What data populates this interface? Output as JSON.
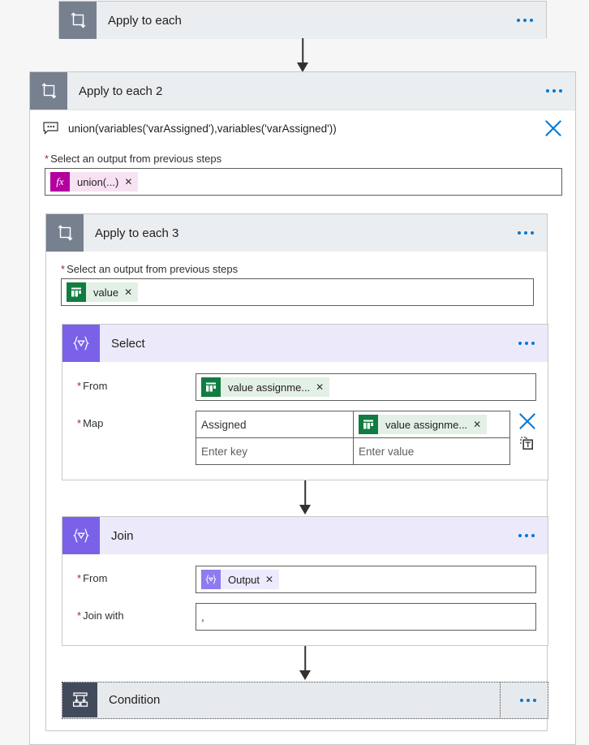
{
  "canvas": {
    "background": "#f6f6f6"
  },
  "colors": {
    "loop_header_icon": "#76808f",
    "loop_header_bar": "#eaeef1",
    "data_op_icon": "#7b61e8",
    "data_op_bar": "#ece9fb",
    "control_icon": "#424b5c",
    "accent_blue": "#0078d4",
    "required_red": "#a4262c",
    "excel_green": "#107c41",
    "expression_magenta": "#b4009e"
  },
  "steps": {
    "apply_to_each_1": {
      "title": "Apply to each",
      "icon": "loop-icon",
      "menu": "more-commands"
    },
    "apply_to_each_2": {
      "title": "Apply to each 2",
      "icon": "loop-icon",
      "menu": "more-commands",
      "expression": {
        "icon": "intellisense-callout-icon",
        "text": "union(variables('varAssigned'),variables('varAssigned'))",
        "close": "close-icon"
      },
      "output_field": {
        "label": "Select an output from previous steps",
        "required": true,
        "token": {
          "icon": "fx-icon",
          "icon_glyph": "fx",
          "label": "union(...)",
          "remove": "remove-token"
        }
      }
    },
    "apply_to_each_3": {
      "title": "Apply to each 3",
      "icon": "loop-icon",
      "menu": "more-commands",
      "output_field": {
        "label": "Select an output from previous steps",
        "required": true,
        "token": {
          "icon": "excel-table-icon",
          "label": "value",
          "remove": "remove-token"
        }
      }
    },
    "select": {
      "title": "Select",
      "icon": "data-operation-icon",
      "icon_glyph": "{▽}",
      "menu": "more-commands",
      "from": {
        "label": "From",
        "required": true,
        "token": {
          "icon": "excel-table-icon",
          "label": "value assignme...",
          "remove": "remove-token"
        }
      },
      "map": {
        "label": "Map",
        "required": true,
        "rows": [
          {
            "key": "Assigned",
            "key_is_placeholder": false,
            "value_token": {
              "icon": "excel-table-icon",
              "label": "value assignme...",
              "remove": "remove-token"
            }
          },
          {
            "key": "Enter key",
            "key_is_placeholder": true,
            "value": "Enter value",
            "value_is_placeholder": true
          }
        ],
        "actions": {
          "delete": "delete-row-icon",
          "switch": "switch-to-text-mode-icon"
        }
      }
    },
    "join": {
      "title": "Join",
      "icon": "data-operation-icon",
      "icon_glyph": "{▽}",
      "menu": "more-commands",
      "from": {
        "label": "From",
        "required": true,
        "token": {
          "icon": "data-operation-token-icon",
          "icon_glyph": "{▽}",
          "label": "Output",
          "remove": "remove-token"
        }
      },
      "join_with": {
        "label": "Join with",
        "required": true,
        "value": ","
      }
    },
    "condition": {
      "title": "Condition",
      "icon": "condition-branch-icon",
      "menu": "more-commands",
      "focused": true
    }
  }
}
